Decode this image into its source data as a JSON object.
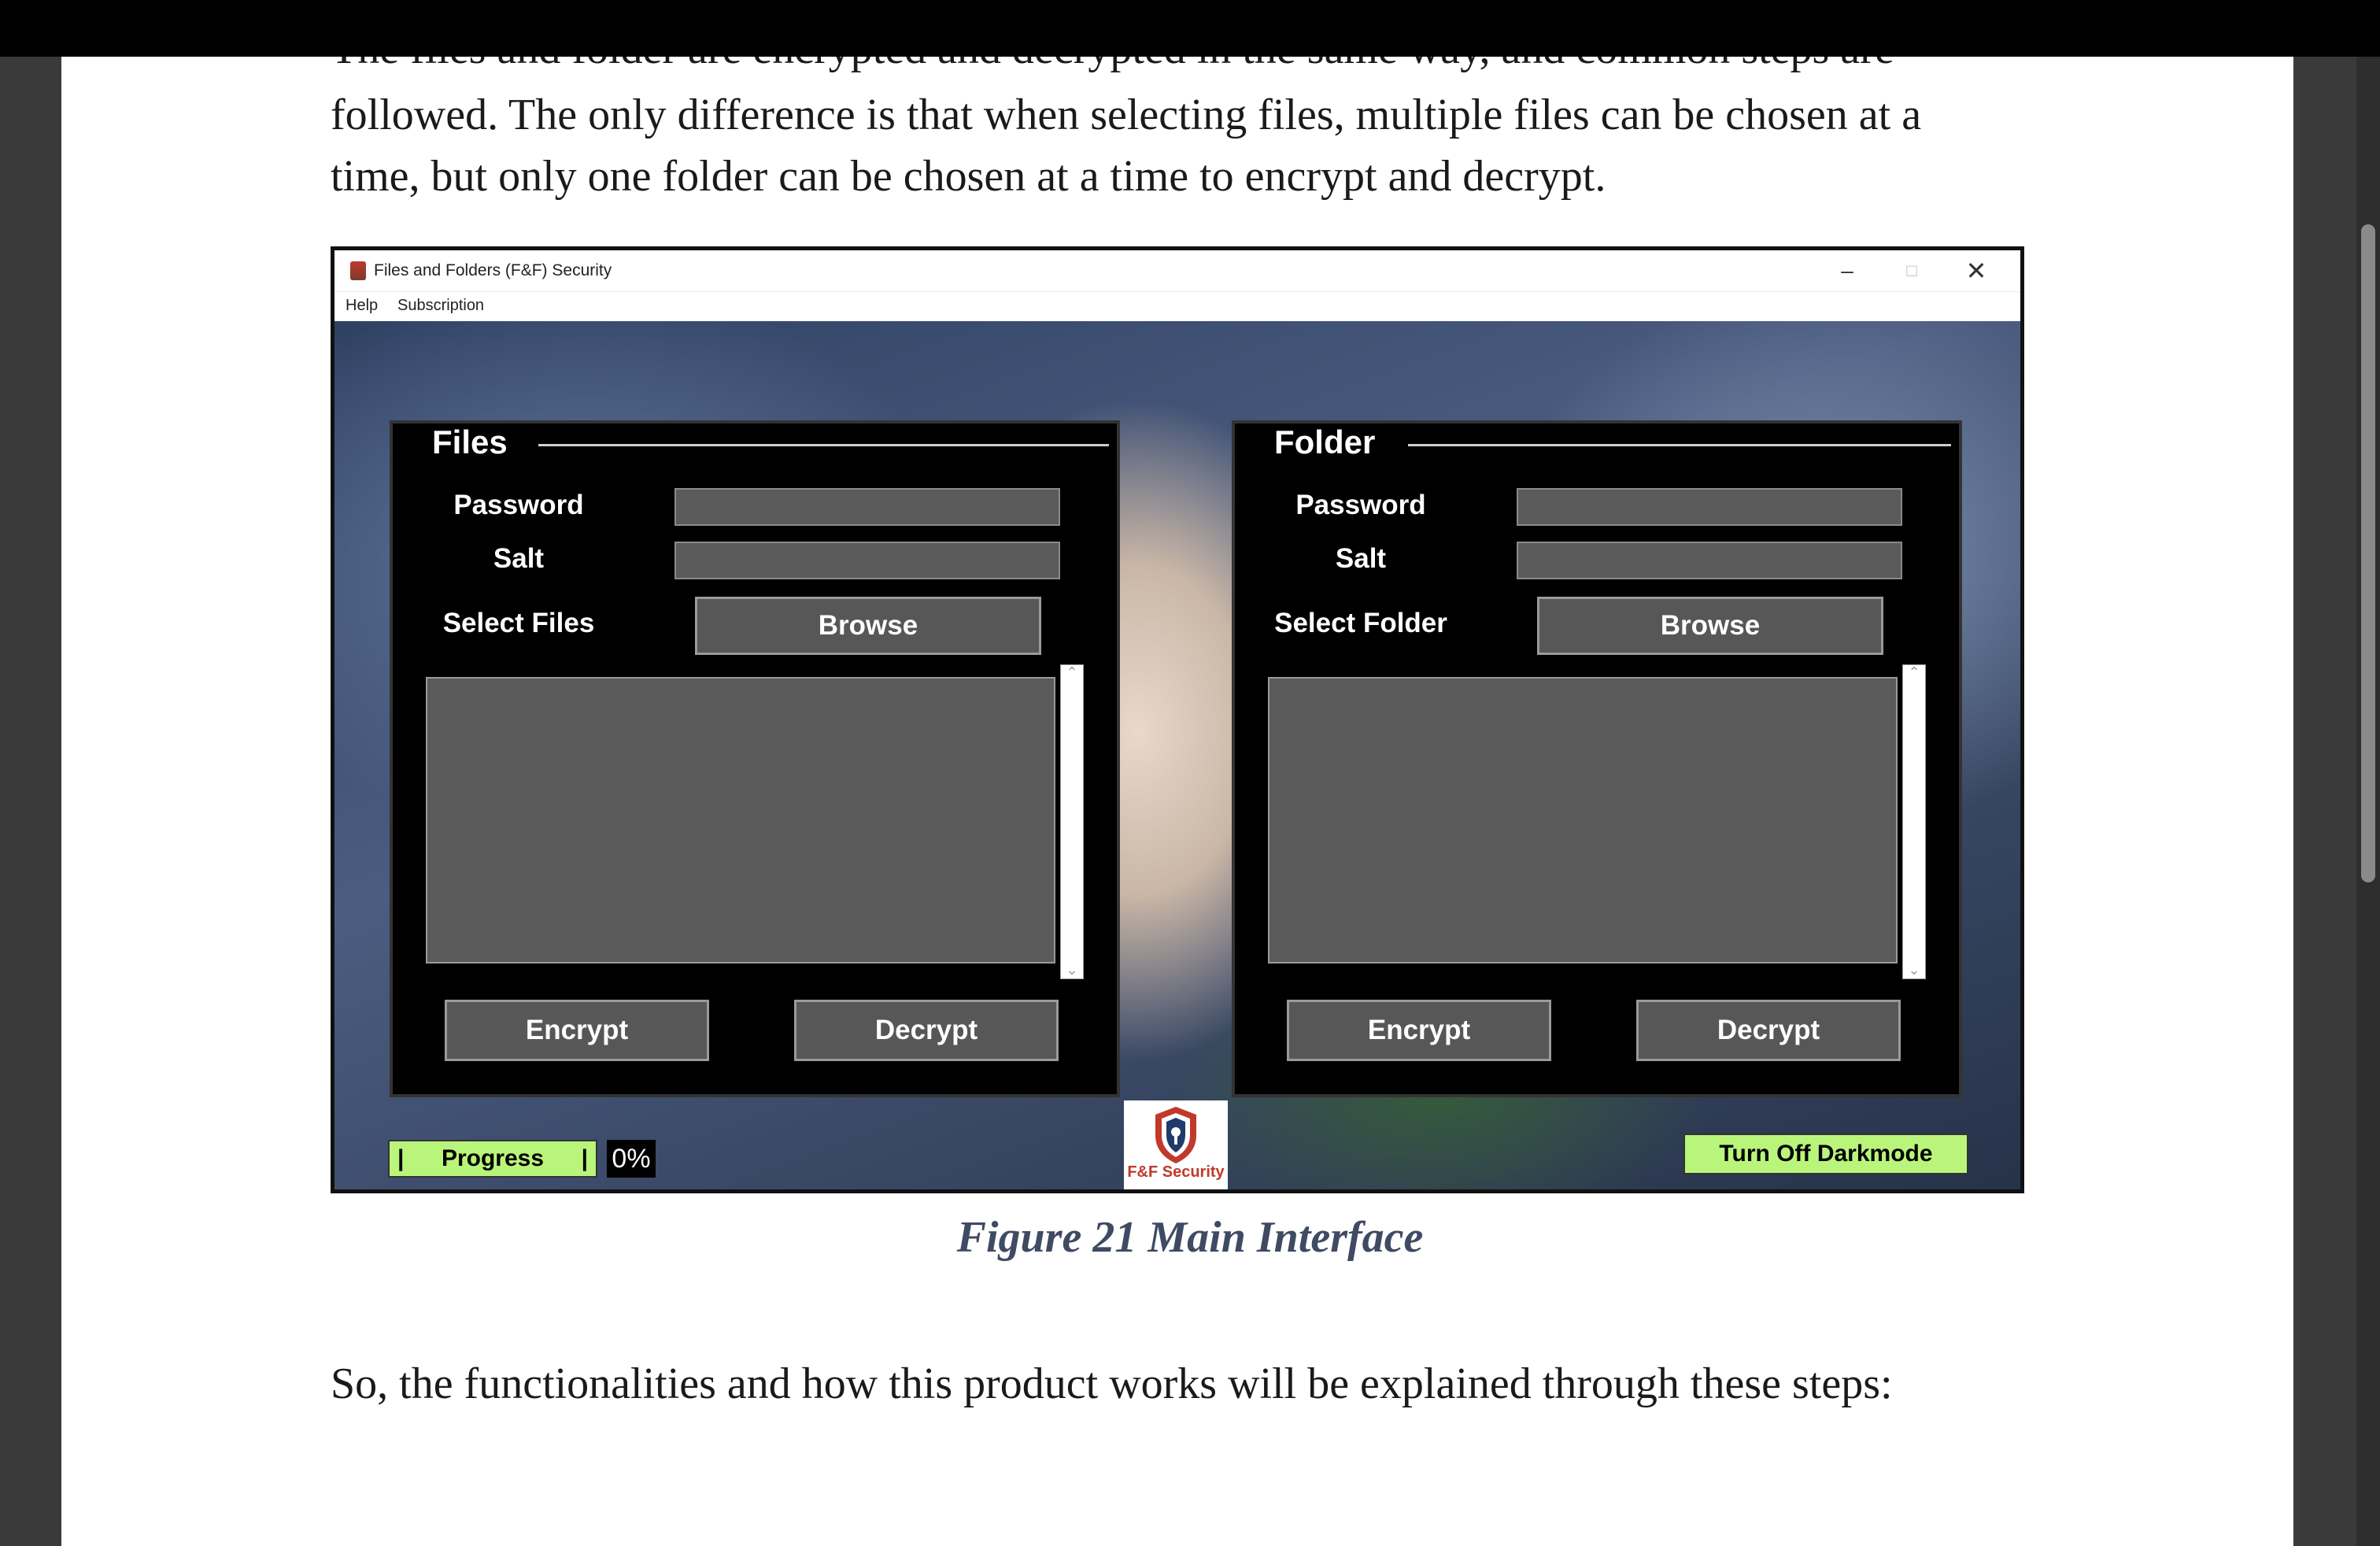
{
  "document": {
    "paragraph_lines": [
      "The files and folder are encrypted and decrypted in the same way, and common steps are",
      "followed. The only difference is that when selecting files, multiple files can be chosen at a",
      "time, but only one folder can be chosen at a time to encrypt and decrypt."
    ],
    "caption": "Figure 21 Main Interface",
    "closing_text": "So, the functionalities and how this product works will be explained through these steps:"
  },
  "app": {
    "window_title": "Files and Folders (F&F) Security",
    "window_controls": {
      "minimize": "–",
      "maximize": "□",
      "close": "✕"
    },
    "menu": [
      "Help",
      "Subscription"
    ],
    "files_panel": {
      "title": "Files",
      "password_label": "Password",
      "salt_label": "Salt",
      "select_label": "Select Files",
      "browse_label": "Browse",
      "encrypt_label": "Encrypt",
      "decrypt_label": "Decrypt"
    },
    "folder_panel": {
      "title": "Folder",
      "password_label": "Password",
      "salt_label": "Salt",
      "select_label": "Select Folder",
      "browse_label": "Browse",
      "encrypt_label": "Encrypt",
      "decrypt_label": "Decrypt"
    },
    "progress": {
      "bar_left": "|",
      "label": "Progress",
      "bar_right": "|",
      "percent_text": "0%",
      "value": 0
    },
    "logo_text": "F&F Security",
    "darkmode_label": "Turn Off Darkmode",
    "colors": {
      "accent_green": "#b9f57a",
      "logo_red": "#c0392b",
      "panel_bg": "#000000",
      "field_gray": "#5a5a5a"
    }
  }
}
